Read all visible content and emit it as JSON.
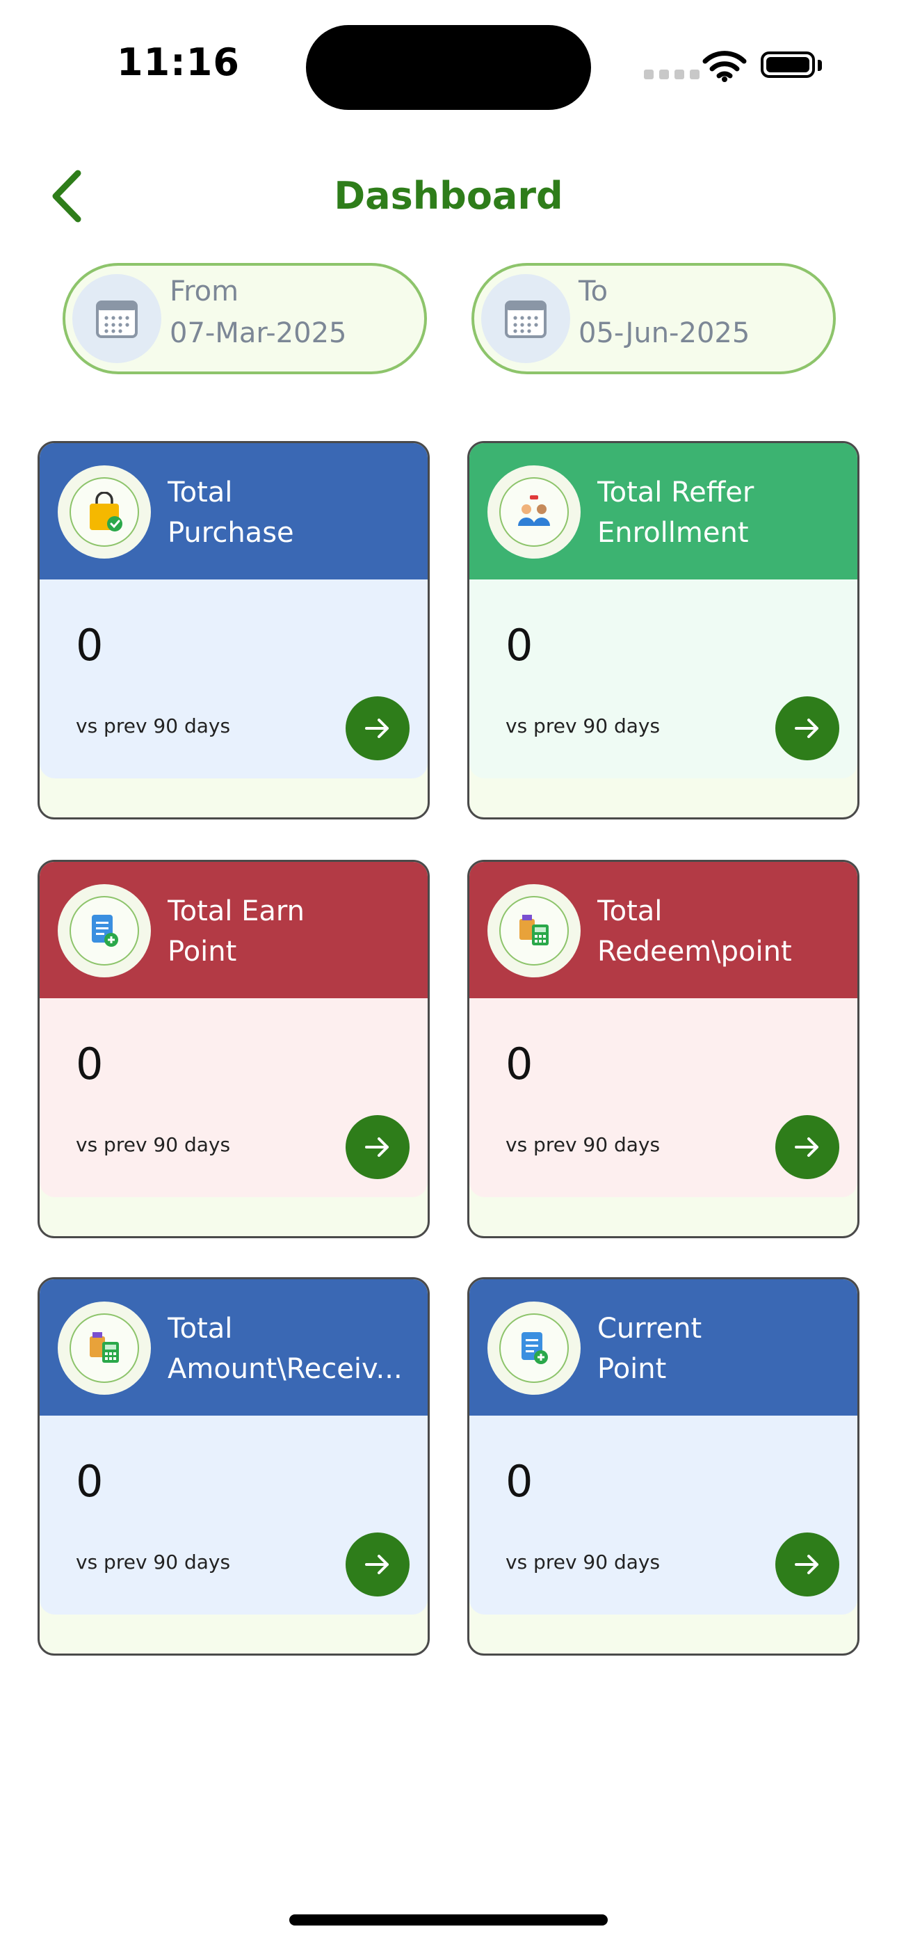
{
  "status_bar": {
    "time": "11:16"
  },
  "header": {
    "title": "Dashboard"
  },
  "date_range": {
    "from": {
      "label": "From",
      "value": "07-Mar-2025"
    },
    "to": {
      "label": "To",
      "value": "05-Jun-2025"
    }
  },
  "cards": [
    {
      "title_line1": "Total",
      "title_line2": "Purchase",
      "value": "0",
      "subtitle": "vs prev 90 days",
      "icon": "shopping-bag-icon",
      "header_color": "#3a68b4",
      "body_color": "#e8f1fd"
    },
    {
      "title_line1": "Total Reffer",
      "title_line2": "Enrollment",
      "value": "0",
      "subtitle": "vs prev 90 days",
      "icon": "referral-users-icon",
      "header_color": "#3cb371",
      "body_color": "#effbf4"
    },
    {
      "title_line1": "Total Earn",
      "title_line2": "Point",
      "value": "0",
      "subtitle": "vs prev 90 days",
      "icon": "document-coin-icon",
      "header_color": "#b33a45",
      "body_color": "#fdefef"
    },
    {
      "title_line1": "Total",
      "title_line2": "Redeem\\point",
      "value": "0",
      "subtitle": "vs prev 90 days",
      "icon": "redeem-calculator-icon",
      "header_color": "#b33a45",
      "body_color": "#fdefef"
    },
    {
      "title_line1": "Total",
      "title_line2": "Amount\\Receiv...",
      "value": "0",
      "subtitle": "vs prev 90 days",
      "icon": "amount-calculator-icon",
      "header_color": "#3a68b4",
      "body_color": "#e8f1fd"
    },
    {
      "title_line1": "Current",
      "title_line2": "Point",
      "value": "0",
      "subtitle": "vs prev 90 days",
      "icon": "document-coin-icon",
      "header_color": "#3a68b4",
      "body_color": "#e8f1fd"
    }
  ],
  "colors": {
    "accent": "#2e7d1a",
    "pill_border": "#8dc46b",
    "pill_bg": "#f6fcec"
  }
}
